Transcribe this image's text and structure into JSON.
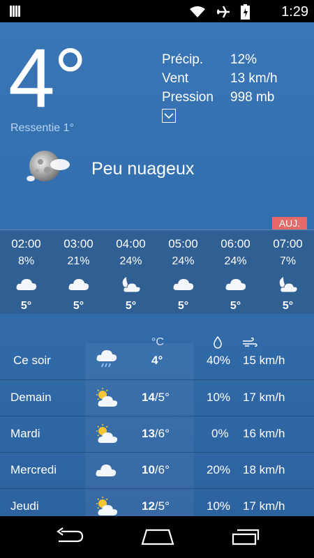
{
  "status_bar": {
    "time": "1:29"
  },
  "current": {
    "temperature": "4°",
    "feels_like": "Ressentie 1°",
    "condition": "Peu nuageux",
    "stats": [
      {
        "label": "Précip.",
        "value": "12%"
      },
      {
        "label": "Vent",
        "value": "13 km/h"
      },
      {
        "label": "Pression",
        "value": "998 mb"
      }
    ]
  },
  "hourly": {
    "badge": "AUJ.",
    "items": [
      {
        "time": "02:00",
        "precip": "8%",
        "temp": "5°",
        "icon": "cloud-icon"
      },
      {
        "time": "03:00",
        "precip": "21%",
        "temp": "5°",
        "icon": "cloud-icon"
      },
      {
        "time": "04:00",
        "precip": "24%",
        "temp": "5°",
        "icon": "moon-cloud-icon"
      },
      {
        "time": "05:00",
        "precip": "24%",
        "temp": "5°",
        "icon": "cloud-icon"
      },
      {
        "time": "06:00",
        "precip": "24%",
        "temp": "5°",
        "icon": "cloud-icon"
      },
      {
        "time": "07:00",
        "precip": "7%",
        "temp": "5°",
        "icon": "moon-cloud-icon"
      }
    ]
  },
  "daily": {
    "unit_header": "°C",
    "rows": [
      {
        "day": "Ce soir",
        "high": "",
        "low": "4°",
        "precip": "40%",
        "wind": "15 km/h",
        "icon": "rain-cloud-icon"
      },
      {
        "day": "Demain",
        "high": "14",
        "low": "/5°",
        "precip": "10%",
        "wind": "17 km/h",
        "icon": "sun-cloud-icon"
      },
      {
        "day": "Mardi",
        "high": "13",
        "low": "/6°",
        "precip": "0%",
        "wind": "16 km/h",
        "icon": "sun-cloud-icon"
      },
      {
        "day": "Mercredi",
        "high": "10",
        "low": "/6°",
        "precip": "20%",
        "wind": "18 km/h",
        "icon": "cloud-icon"
      },
      {
        "day": "Jeudi",
        "high": "12",
        "low": "/5°",
        "precip": "10%",
        "wind": "17 km/h",
        "icon": "sun-cloud-icon"
      }
    ]
  },
  "colors": {
    "accent_badge": "#e36a66",
    "background": "#336fae",
    "feels_like": "#b7d3f2"
  }
}
